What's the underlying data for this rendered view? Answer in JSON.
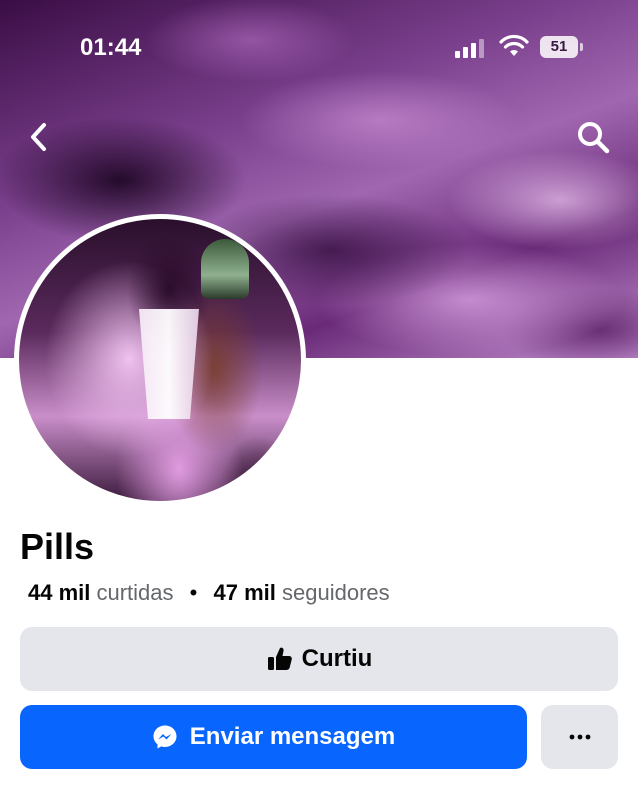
{
  "status_bar": {
    "time": "01:44",
    "battery": "51",
    "icons": [
      "signal-icon",
      "wifi-icon",
      "battery-icon"
    ]
  },
  "header": {
    "icons": [
      "back-icon",
      "search-icon"
    ]
  },
  "profile": {
    "name": "Pills",
    "likes_count": "44 mil",
    "likes_label": "curtidas",
    "separator": "•",
    "followers_count": "47 mil",
    "followers_label": "seguidores"
  },
  "actions": {
    "like_label": "Curtiu",
    "like_icon": "thumbs-up-icon",
    "message_label": "Enviar mensagem",
    "message_icon": "messenger-icon",
    "more_icon": "more-icon"
  },
  "colors": {
    "primary_blue": "#0866ff",
    "button_gray": "#e4e6eb",
    "secondary_text": "#65676b"
  }
}
